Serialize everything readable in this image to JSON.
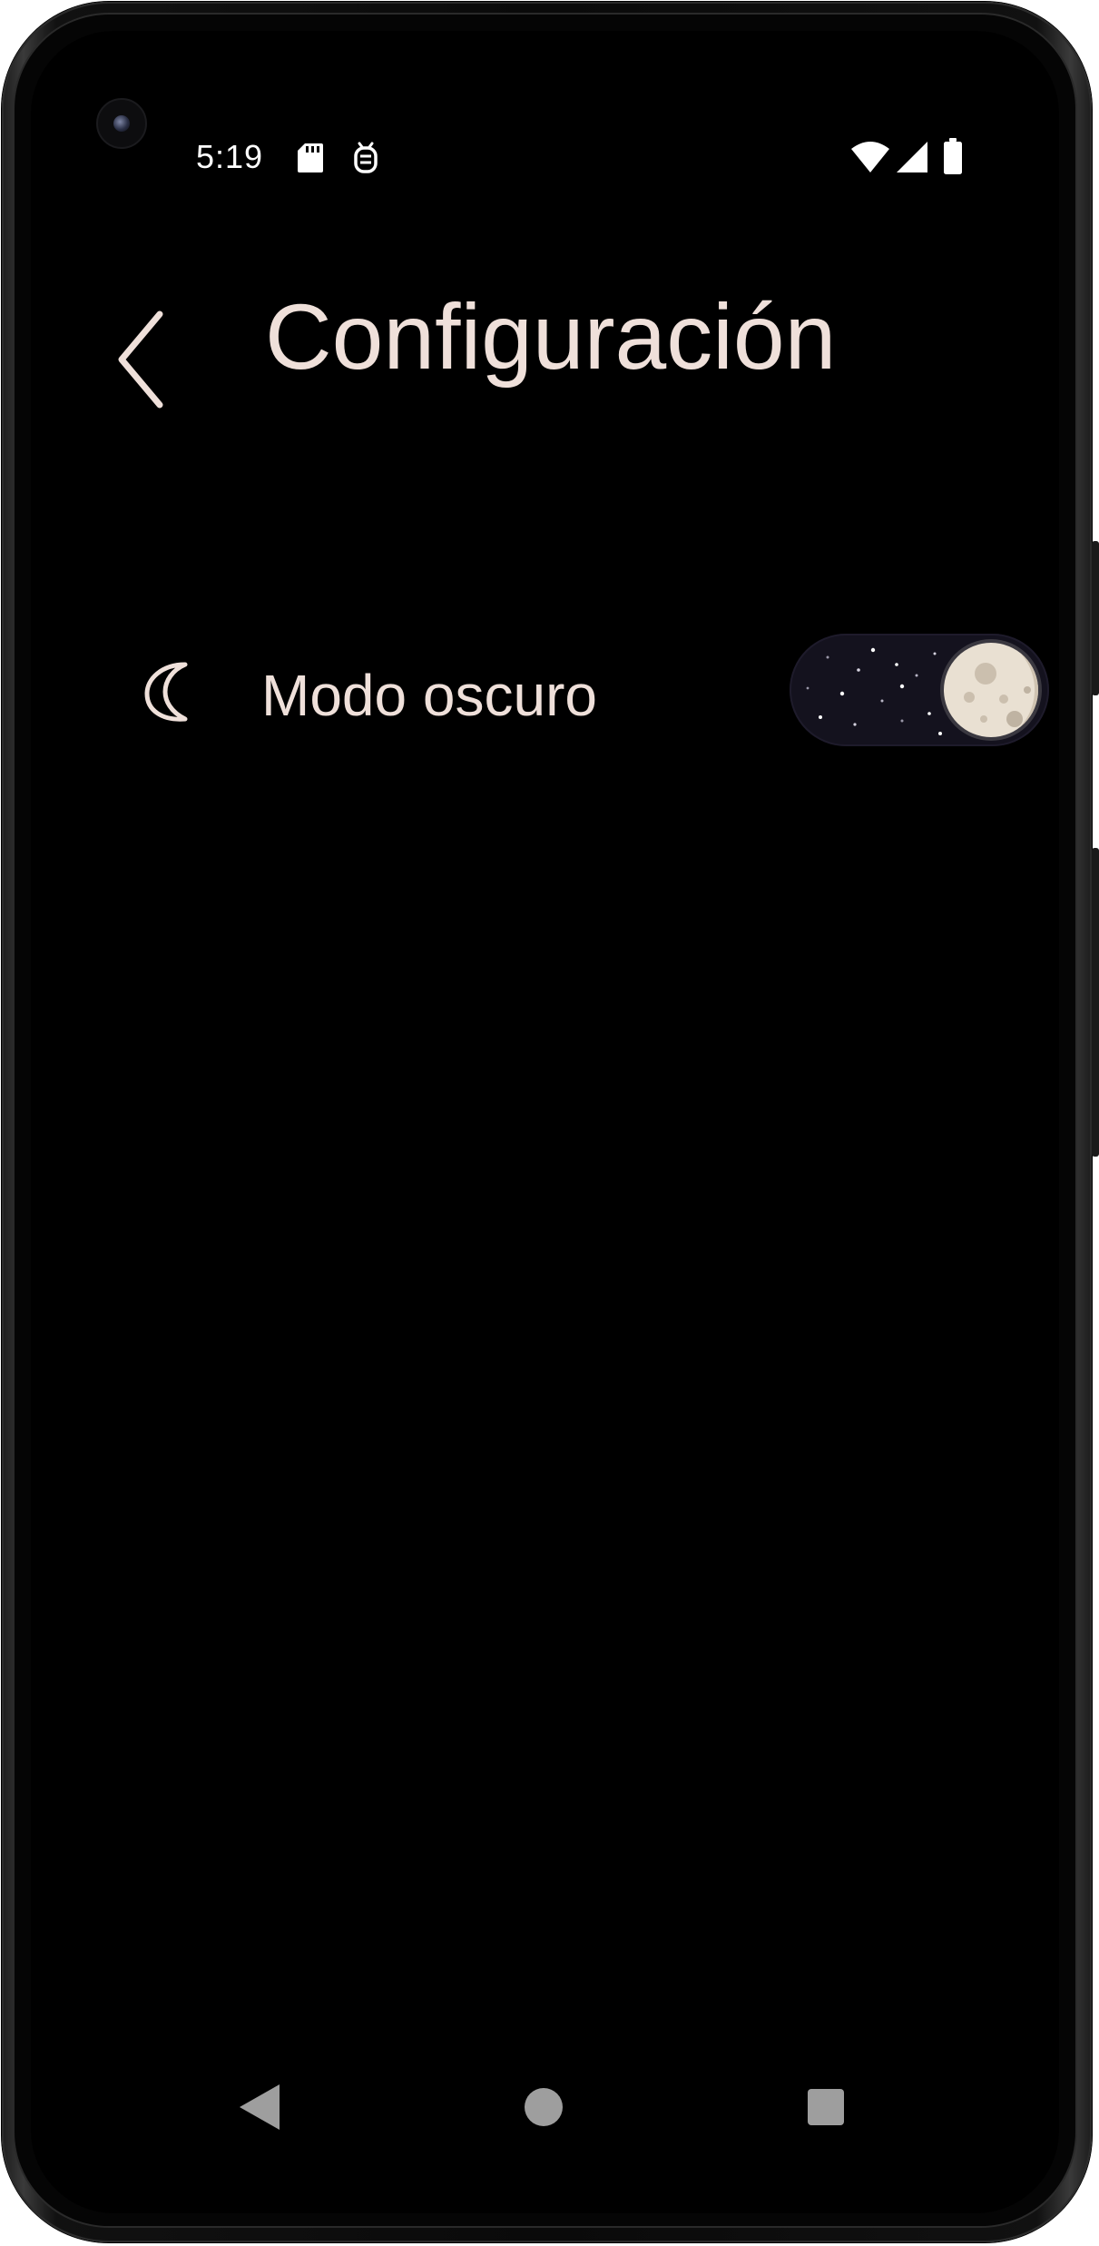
{
  "status_bar": {
    "time": "5:19",
    "left_icons": [
      "sd-card-icon",
      "debug-bug-icon"
    ],
    "right_icons": [
      "wifi-icon",
      "cell-signal-icon",
      "battery-icon"
    ]
  },
  "header": {
    "back_icon": "chevron-left-icon",
    "title": "Configuración"
  },
  "settings": {
    "dark_mode": {
      "icon": "moon-outline-icon",
      "label": "Modo oscuro",
      "enabled": true
    }
  },
  "nav_bar": {
    "icons": [
      "nav-back-icon",
      "nav-home-icon",
      "nav-recents-icon"
    ]
  },
  "colors": {
    "screen_background": "#000000",
    "text_primary": "#efe0da",
    "toggle_track": "#14121e",
    "toggle_thumb": "#e9e0d2",
    "nav_icons": "#9e9e9e"
  }
}
